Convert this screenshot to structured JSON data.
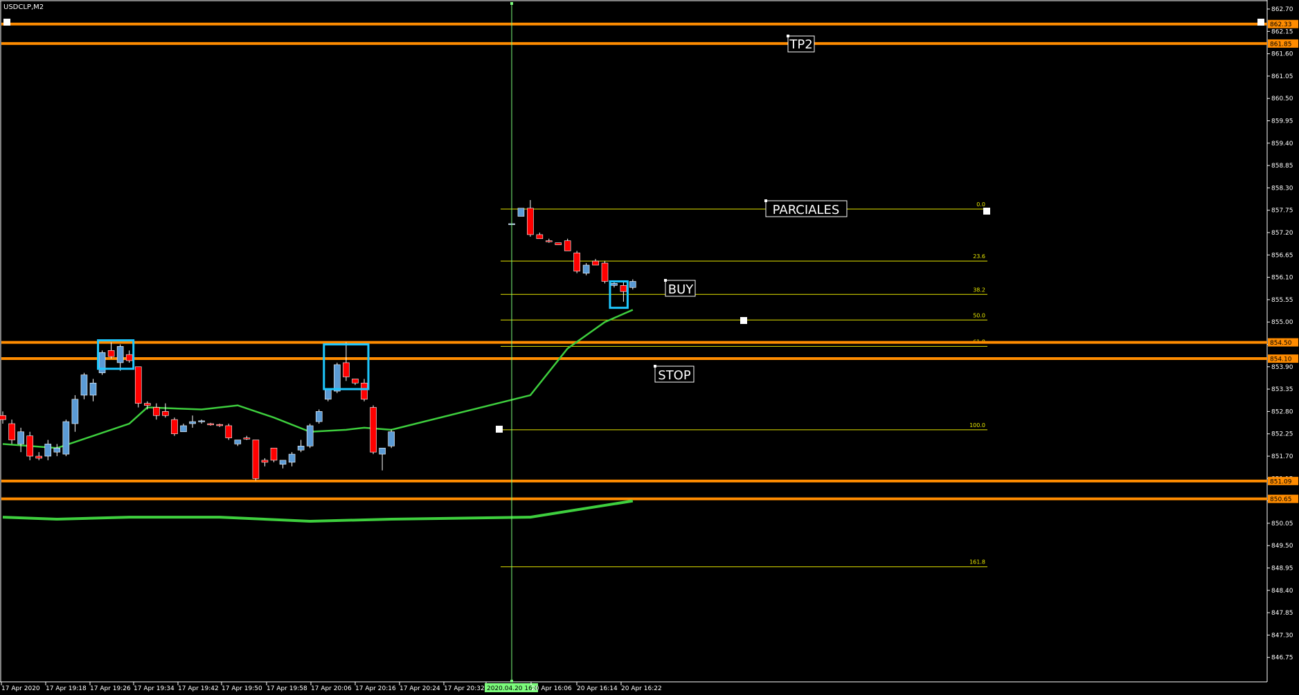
{
  "window": {
    "title": "USDCLP,M2"
  },
  "colors": {
    "background": "#000000",
    "axis": "#ffffff",
    "bull": "#5b9bd5",
    "bear": "#ff0000",
    "level_line": "#ff8c00",
    "fib": "#e6e600",
    "ma_fast": "#3ecf3e",
    "ma_slow": "#3ecf3e",
    "zone_box": "#1ec8ff",
    "crosshair": "#7cfc7c"
  },
  "price_axis": {
    "labels": [
      "862.70",
      "862.15",
      "861.60",
      "861.05",
      "860.50",
      "859.95",
      "859.40",
      "858.85",
      "858.30",
      "857.75",
      "857.20",
      "856.65",
      "856.10",
      "855.55",
      "855.00",
      "854.45",
      "853.90",
      "853.35",
      "852.80",
      "852.25",
      "851.70",
      "851.15",
      "850.60",
      "850.05",
      "849.50",
      "848.95",
      "848.40",
      "847.85",
      "847.30",
      "846.75"
    ],
    "tags": [
      {
        "text": "862.33",
        "price": 862.33
      },
      {
        "text": "861.85",
        "price": 861.85
      },
      {
        "text": "854.50",
        "price": 854.5
      },
      {
        "text": "854.10",
        "price": 854.1
      },
      {
        "text": "851.09",
        "price": 851.09
      },
      {
        "text": "850.65",
        "price": 850.65
      }
    ]
  },
  "time_axis": {
    "labels": [
      "17 Apr 2020",
      "17 Apr 19:18",
      "17 Apr 19:26",
      "17 Apr 19:34",
      "17 Apr 19:42",
      "17 Apr 19:50",
      "17 Apr 19:58",
      "17 Apr 20:06",
      "17 Apr 20:16",
      "17 Apr 20:24",
      "17 Apr 20:32",
      "2020.04.20 16:00",
      "20 Apr 16:06",
      "20 Apr 16:14",
      "20 Apr 16:22"
    ],
    "crosshair_label": "2020.04.20 16:00"
  },
  "annotations": {
    "tp2": "TP2",
    "parciales": "PARCIALES",
    "buy": "BUY",
    "stop": "STOP"
  },
  "fibonacci": {
    "levels": [
      {
        "label": "0.0",
        "price": 857.78
      },
      {
        "label": "23.6",
        "price": 856.5
      },
      {
        "label": "38.2",
        "price": 855.68
      },
      {
        "label": "50.0",
        "price": 855.05
      },
      {
        "label": "61.8",
        "price": 854.4
      },
      {
        "label": "100.0",
        "price": 852.35
      },
      {
        "label": "161.8",
        "price": 848.98
      }
    ]
  },
  "chart_data": {
    "type": "candlestick",
    "symbol": "USDCLP",
    "timeframe": "M2",
    "ylim": [
      846.3,
      863.0
    ],
    "horizontal_levels": [
      862.33,
      861.85,
      854.5,
      854.1,
      851.09,
      850.65
    ],
    "candles": [
      {
        "o": 852.7,
        "h": 852.8,
        "l": 852.5,
        "c": 852.6
      },
      {
        "o": 852.5,
        "h": 852.6,
        "l": 852.0,
        "c": 852.1
      },
      {
        "o": 852.0,
        "h": 852.4,
        "l": 851.8,
        "c": 852.3
      },
      {
        "o": 852.2,
        "h": 852.3,
        "l": 851.6,
        "c": 851.7
      },
      {
        "o": 851.7,
        "h": 851.8,
        "l": 851.6,
        "c": 851.65
      },
      {
        "o": 851.7,
        "h": 852.1,
        "l": 851.6,
        "c": 852.0
      },
      {
        "o": 851.8,
        "h": 852.0,
        "l": 851.7,
        "c": 851.9
      },
      {
        "o": 851.75,
        "h": 852.6,
        "l": 851.7,
        "c": 852.55
      },
      {
        "o": 852.5,
        "h": 853.2,
        "l": 852.3,
        "c": 853.1
      },
      {
        "o": 853.2,
        "h": 853.75,
        "l": 853.1,
        "c": 853.7
      },
      {
        "o": 853.2,
        "h": 853.6,
        "l": 853.05,
        "c": 853.5
      },
      {
        "o": 853.75,
        "h": 854.3,
        "l": 853.7,
        "c": 854.25
      },
      {
        "o": 854.3,
        "h": 854.5,
        "l": 854.1,
        "c": 854.15
      },
      {
        "o": 854.0,
        "h": 854.45,
        "l": 853.8,
        "c": 854.4
      },
      {
        "o": 854.2,
        "h": 854.3,
        "l": 854.0,
        "c": 854.05
      },
      {
        "o": 853.9,
        "h": 853.9,
        "l": 852.9,
        "c": 853.0
      },
      {
        "o": 853.0,
        "h": 853.05,
        "l": 852.85,
        "c": 852.95
      },
      {
        "o": 852.9,
        "h": 853.0,
        "l": 852.6,
        "c": 852.7
      },
      {
        "o": 852.8,
        "h": 853.0,
        "l": 852.65,
        "c": 852.7
      },
      {
        "o": 852.6,
        "h": 852.65,
        "l": 852.2,
        "c": 852.25
      },
      {
        "o": 852.3,
        "h": 852.5,
        "l": 852.3,
        "c": 852.45
      },
      {
        "o": 852.5,
        "h": 852.7,
        "l": 852.4,
        "c": 852.55
      },
      {
        "o": 852.55,
        "h": 852.6,
        "l": 852.5,
        "c": 852.57
      },
      {
        "o": 852.5,
        "h": 852.52,
        "l": 852.45,
        "c": 852.47
      },
      {
        "o": 852.48,
        "h": 852.5,
        "l": 852.42,
        "c": 852.45
      },
      {
        "o": 852.45,
        "h": 852.5,
        "l": 852.1,
        "c": 852.15
      },
      {
        "o": 852.0,
        "h": 852.1,
        "l": 851.95,
        "c": 852.1
      },
      {
        "o": 852.15,
        "h": 852.2,
        "l": 852.1,
        "c": 852.12
      },
      {
        "o": 852.1,
        "h": 852.1,
        "l": 851.1,
        "c": 851.15
      },
      {
        "o": 851.6,
        "h": 851.65,
        "l": 851.45,
        "c": 851.55
      },
      {
        "o": 851.9,
        "h": 851.9,
        "l": 851.55,
        "c": 851.6
      },
      {
        "o": 851.5,
        "h": 851.6,
        "l": 851.4,
        "c": 851.6
      },
      {
        "o": 851.55,
        "h": 851.8,
        "l": 851.45,
        "c": 851.75
      },
      {
        "o": 851.85,
        "h": 852.1,
        "l": 851.8,
        "c": 851.95
      },
      {
        "o": 851.95,
        "h": 852.5,
        "l": 851.9,
        "c": 852.45
      },
      {
        "o": 852.55,
        "h": 852.85,
        "l": 852.5,
        "c": 852.8
      },
      {
        "o": 853.1,
        "h": 853.2,
        "l": 853.05,
        "c": 853.35
      },
      {
        "o": 853.3,
        "h": 854.0,
        "l": 853.25,
        "c": 853.95
      },
      {
        "o": 854.0,
        "h": 854.5,
        "l": 853.55,
        "c": 853.65
      },
      {
        "o": 853.6,
        "h": 853.6,
        "l": 853.45,
        "c": 853.5
      },
      {
        "o": 853.5,
        "h": 853.6,
        "l": 853.05,
        "c": 853.1
      },
      {
        "o": 852.9,
        "h": 852.95,
        "l": 851.75,
        "c": 851.8
      },
      {
        "o": 851.75,
        "h": 851.85,
        "l": 851.35,
        "c": 851.9
      },
      {
        "o": 851.95,
        "h": 852.35,
        "l": 851.9,
        "c": 852.3
      },
      {
        "o": 857.4,
        "h": 857.45,
        "l": 857.35,
        "c": 857.42
      },
      {
        "o": 857.6,
        "h": 857.7,
        "l": 857.6,
        "c": 857.8
      },
      {
        "o": 857.8,
        "h": 858.0,
        "l": 857.1,
        "c": 857.15
      },
      {
        "o": 857.15,
        "h": 857.2,
        "l": 857.05,
        "c": 857.05
      },
      {
        "o": 857.0,
        "h": 857.05,
        "l": 856.95,
        "c": 856.98
      },
      {
        "o": 856.95,
        "h": 856.95,
        "l": 856.9,
        "c": 856.9
      },
      {
        "o": 857.0,
        "h": 857.05,
        "l": 856.75,
        "c": 856.75
      },
      {
        "o": 856.7,
        "h": 856.75,
        "l": 856.2,
        "c": 856.25
      },
      {
        "o": 856.2,
        "h": 856.45,
        "l": 856.15,
        "c": 856.4
      },
      {
        "o": 856.5,
        "h": 856.55,
        "l": 856.4,
        "c": 856.4
      },
      {
        "o": 856.45,
        "h": 856.5,
        "l": 855.95,
        "c": 856.0
      },
      {
        "o": 855.9,
        "h": 856.0,
        "l": 855.85,
        "c": 855.95
      },
      {
        "o": 855.9,
        "h": 856.0,
        "l": 855.5,
        "c": 855.75
      },
      {
        "o": 855.85,
        "h": 856.05,
        "l": 855.8,
        "c": 856.0
      }
    ],
    "ma_fast": [
      [
        0,
        852.0
      ],
      [
        6,
        851.9
      ],
      [
        14,
        852.5
      ],
      [
        16,
        852.9
      ],
      [
        22,
        852.85
      ],
      [
        26,
        852.95
      ],
      [
        30,
        852.65
      ],
      [
        34,
        852.3
      ],
      [
        38,
        852.35
      ],
      [
        40,
        852.4
      ],
      [
        43,
        852.35
      ],
      [
        46,
        853.2
      ],
      [
        50,
        854.35
      ],
      [
        54,
        855.0
      ],
      [
        57,
        855.3
      ]
    ],
    "ma_slow": [
      [
        0,
        850.2
      ],
      [
        6,
        850.15
      ],
      [
        14,
        850.2
      ],
      [
        24,
        850.2
      ],
      [
        34,
        850.1
      ],
      [
        43,
        850.15
      ],
      [
        46,
        850.2
      ],
      [
        57,
        850.6
      ]
    ]
  }
}
